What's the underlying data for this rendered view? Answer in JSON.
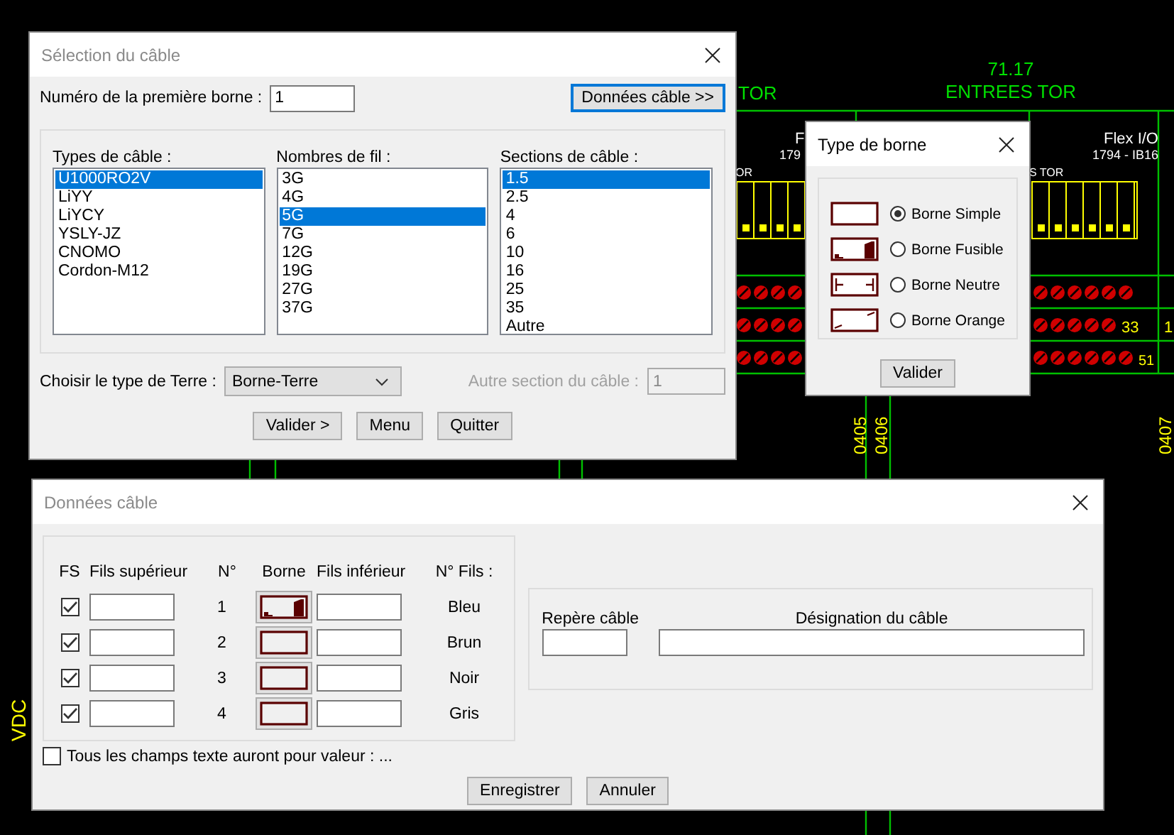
{
  "background_drawing": {
    "texts": [
      "TOR",
      "71.17",
      "ENTREES TOR",
      "F",
      "179",
      "Flex I/O",
      "1794 - IB16",
      "OR",
      "S TOR",
      "33",
      "51",
      "1",
      "0405",
      "0406",
      "0407",
      "VDC"
    ]
  },
  "cable_selection": {
    "title": "Sélection du câble",
    "first_terminal_label": "Numéro de la première borne :",
    "first_terminal_value": "1",
    "cable_data_button": "Données câble >>",
    "lists": [
      {
        "label": "Types de câble :",
        "items": [
          {
            "text": "U1000RO2V",
            "selected": true
          },
          {
            "text": "LiYY",
            "selected": false
          },
          {
            "text": "LiYCY",
            "selected": false
          },
          {
            "text": "YSLY-JZ",
            "selected": false
          },
          {
            "text": "CNOMO",
            "selected": false
          },
          {
            "text": "Cordon-M12",
            "selected": false
          }
        ]
      },
      {
        "label": "Nombres de fil :",
        "items": [
          {
            "text": "3G",
            "selected": false
          },
          {
            "text": "4G",
            "selected": false
          },
          {
            "text": "5G",
            "selected": true
          },
          {
            "text": "7G",
            "selected": false
          },
          {
            "text": "12G",
            "selected": false
          },
          {
            "text": "19G",
            "selected": false
          },
          {
            "text": "27G",
            "selected": false
          },
          {
            "text": "37G",
            "selected": false
          }
        ]
      },
      {
        "label": "Sections de câble :",
        "items": [
          {
            "text": "1.5",
            "selected": true
          },
          {
            "text": "2.5",
            "selected": false
          },
          {
            "text": "4",
            "selected": false
          },
          {
            "text": "6",
            "selected": false
          },
          {
            "text": "10",
            "selected": false
          },
          {
            "text": "16",
            "selected": false
          },
          {
            "text": "25",
            "selected": false
          },
          {
            "text": "35",
            "selected": false
          },
          {
            "text": "Autre",
            "selected": false
          }
        ]
      }
    ],
    "earth_label": "Choisir le type de Terre :",
    "earth_value": "Borne-Terre",
    "other_section_label": "Autre section du câble :",
    "other_section_value": "1",
    "other_section_disabled": true,
    "buttons": [
      "Valider >",
      "Menu",
      "Quitter"
    ]
  },
  "terminal_type": {
    "title": "Type de borne",
    "options": [
      {
        "label": "Borne Simple",
        "kind": "simple",
        "selected": true
      },
      {
        "label": "Borne Fusible",
        "kind": "fusible",
        "selected": false
      },
      {
        "label": "Borne Neutre",
        "kind": "neutre",
        "selected": false
      },
      {
        "label": "Borne Orange",
        "kind": "orange",
        "selected": false
      }
    ],
    "button": "Valider"
  },
  "cable_data": {
    "title": "Données câble",
    "columns": [
      "FS",
      "Fils supérieur",
      "N°",
      "Borne",
      "Fils inférieur",
      "N° Fils :"
    ],
    "rows": [
      {
        "fs_checked": true,
        "number": "1",
        "kind": "fusible",
        "wire_color": "Bleu"
      },
      {
        "fs_checked": true,
        "number": "2",
        "kind": "simple",
        "wire_color": "Brun"
      },
      {
        "fs_checked": true,
        "number": "3",
        "kind": "simple",
        "wire_color": "Noir"
      },
      {
        "fs_checked": true,
        "number": "4",
        "kind": "simple",
        "wire_color": "Gris"
      }
    ],
    "all_fields_checkbox": {
      "label": "Tous les champs texte auront pour valeur : ...",
      "checked": false
    },
    "marker_label": "Repère câble",
    "designation_label": "Désignation du câble",
    "buttons": [
      "Enregistrer",
      "Annuler"
    ]
  }
}
